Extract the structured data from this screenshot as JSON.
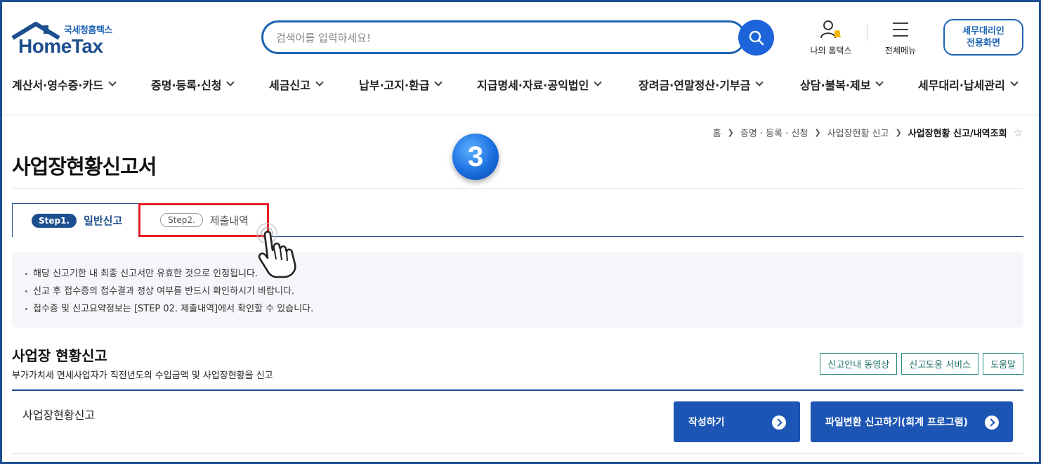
{
  "header": {
    "logo_sub": "국세청홈택스",
    "logo_main": "HomeTax",
    "search_placeholder": "검색어를 입력하세요!",
    "my_home_label": "나의 홈택스",
    "all_menu_label": "전체메뉴",
    "agent_line1": "세무대리인",
    "agent_line2": "전용화면"
  },
  "gnb": [
    "계산서·영수증·카드",
    "증명·등록·신청",
    "세금신고",
    "납부·고지·환급",
    "지급명세·자료·공익법인",
    "장려금·연말정산·기부금",
    "상담·불복·제보",
    "세무대리·납세관리"
  ],
  "breadcrumb": {
    "home": "홈",
    "item1": "증명 · 등록 · 신청",
    "item2": "사업장현황 신고",
    "current": "사업장현황 신고/내역조회",
    "star": "☆"
  },
  "step_marker": "3",
  "page_title": "사업장현황신고서",
  "tabs": [
    {
      "step": "Step1.",
      "label": "일반신고"
    },
    {
      "step": "Step2.",
      "label": "제출내역"
    }
  ],
  "notices": [
    "해당 신고기한 내 최종 신고서만 유효한 것으로 인정됩니다.",
    "신고 후 접수증의 접수결과 정상 여부를 반드시 확인하시기 바랍니다.",
    "접수증 및 신고요약정보는 [STEP 02. 제출내역]에서 확인할 수 있습니다."
  ],
  "section": {
    "title": "사업장 현황신고",
    "desc": "부가가치세 면세사업자가 직전년도의 수입금액 및 사업장현황을 신고",
    "buttons": [
      "신고안내 동영상",
      "신고도움 서비스",
      "도움말"
    ]
  },
  "row": {
    "label": "사업장현황신고",
    "write_btn": "작성하기",
    "file_btn": "파일변환 신고하기(회계 프로그램)"
  },
  "colors": {
    "primary": "#1d4e8f",
    "button_blue": "#1c55b4",
    "highlight_red": "#e51c24",
    "teal": "#2a8a80"
  }
}
